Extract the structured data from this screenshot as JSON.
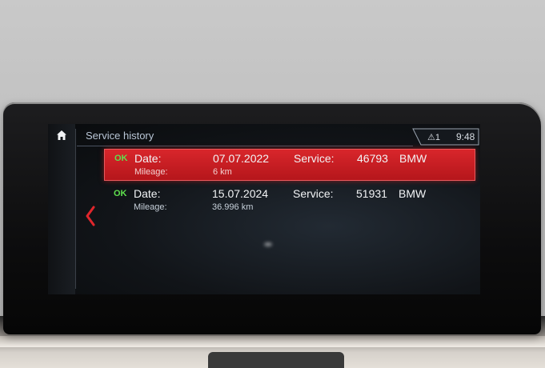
{
  "header": {
    "title": "Service history",
    "warning_count": "1",
    "time": "9:48"
  },
  "icons": {
    "home": "home-icon",
    "back": "chevron-left-icon",
    "warning": "warning-triangle-icon"
  },
  "colors": {
    "selection_red": "#c91d22",
    "ok_green": "#5fe04e",
    "title_text": "#b9c6d6"
  },
  "entries": [
    {
      "status": "OK",
      "date_label": "Date:",
      "date": "07.07.2022",
      "service_label": "Service:",
      "service_number": "46793",
      "brand": "BMW",
      "mileage_label": "Mileage:",
      "mileage": "6 km",
      "selected": true
    },
    {
      "status": "OK",
      "date_label": "Date:",
      "date": "15.07.2024",
      "service_label": "Service:",
      "service_number": "51931",
      "brand": "BMW",
      "mileage_label": "Mileage:",
      "mileage": "36.996 km",
      "selected": false
    }
  ]
}
